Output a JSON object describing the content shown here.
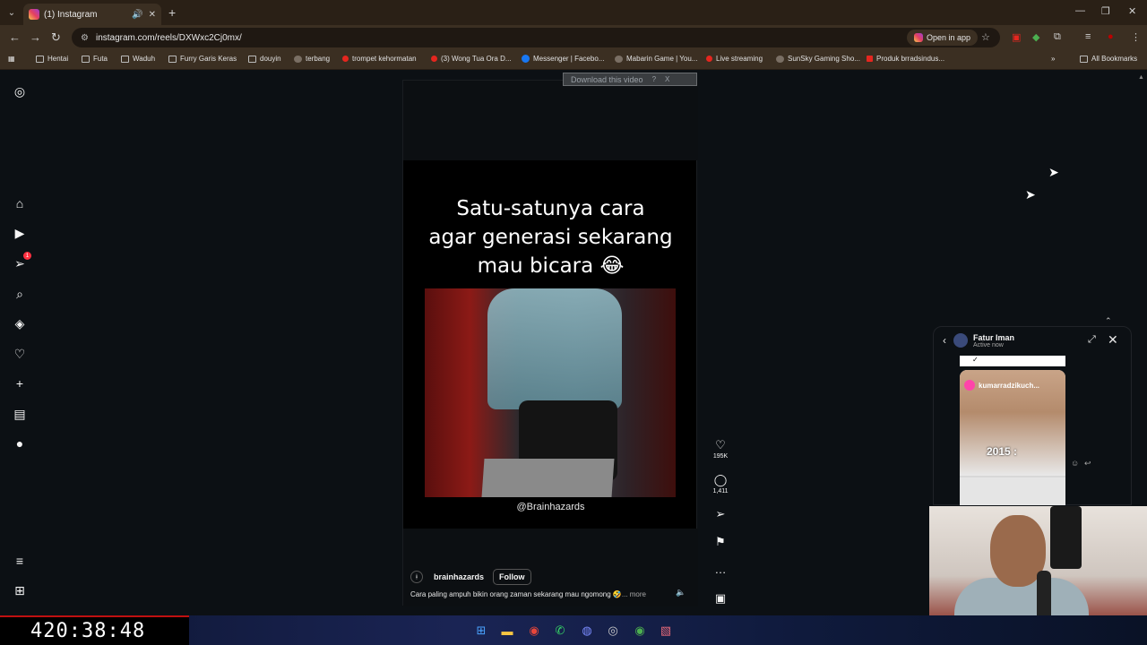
{
  "browser": {
    "tab_title": "(1) Instagram",
    "url": "instagram.com/reels/DXWxc2Cj0mx/",
    "open_in_app": "Open in app",
    "bookmarks": [
      {
        "label": "Hentai",
        "icon": "folder-icon"
      },
      {
        "label": "Futa",
        "icon": "folder-icon"
      },
      {
        "label": "Waduh",
        "icon": "folder-icon"
      },
      {
        "label": "Furry Garis Keras",
        "icon": "folder-icon"
      },
      {
        "label": "douyin",
        "icon": "folder-icon"
      },
      {
        "label": "terbang",
        "icon": "site-icon"
      },
      {
        "label": "trompet kehormatan",
        "icon": "youtube-icon"
      },
      {
        "label": "(3) Wong Tua Ora D...",
        "icon": "youtube-icon"
      },
      {
        "label": "Messenger | Facebo...",
        "icon": "facebook-icon"
      },
      {
        "label": "Mabarin Game | You...",
        "icon": "site-icon"
      },
      {
        "label": "Live streaming",
        "icon": "youtube-icon"
      },
      {
        "label": "SunSky Gaming Sho...",
        "icon": "site-icon"
      },
      {
        "label": "Produk brradsindus...",
        "icon": "shop-icon"
      }
    ],
    "all_bookmarks": "All Bookmarks"
  },
  "download_bar": {
    "label": "Download this video",
    "help": "?",
    "close": "X"
  },
  "reel": {
    "overlay_lines": [
      "Satu-satunya cara",
      "agar generasi sekarang",
      "mau bicara 😂"
    ],
    "watermark": "@Brainhazards",
    "author": "brainhazards",
    "follow": "Follow",
    "description": "Cara paling ampuh bikin orang zaman sekarang mau ngomong 🤣",
    "more": "... more",
    "likes": "195K",
    "comments": "1,411"
  },
  "sidebar": {
    "notification_badge": "1"
  },
  "chat": {
    "name": "Fatur Iman",
    "status": "Active now",
    "shared_user": "kumarradzikuch...",
    "shared_caption": "2015 :"
  },
  "overlay": {
    "timer": "420:38:48"
  },
  "colors": {
    "accent_red": "#ff3040",
    "timer_border": "#c01010",
    "background": "#0c1014"
  }
}
